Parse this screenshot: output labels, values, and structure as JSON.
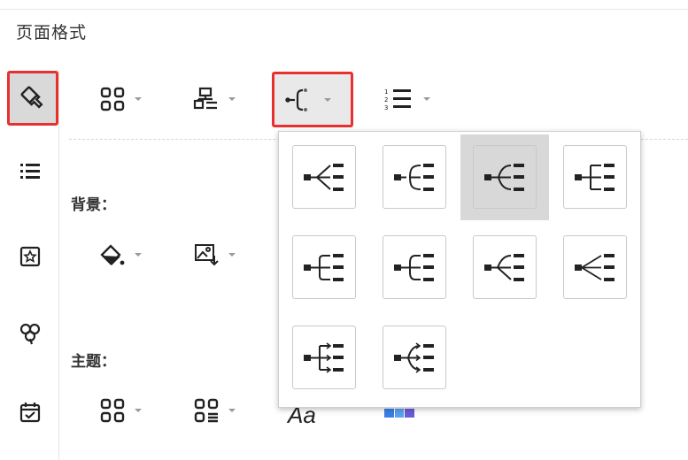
{
  "panel": {
    "title": "页面格式"
  },
  "sections": {
    "background_label": "背景：",
    "theme_label": "主题："
  },
  "sidebar": {
    "items": [
      {
        "icon": "format-brush-icon",
        "active": true
      },
      {
        "icon": "list-icon",
        "active": false
      },
      {
        "icon": "star-frame-icon",
        "active": false
      },
      {
        "icon": "clover-icon",
        "active": false
      },
      {
        "icon": "calendar-check-icon",
        "active": false
      }
    ]
  },
  "toolbar": {
    "buttons": [
      {
        "icon": "layout-grid-icon"
      },
      {
        "icon": "org-structure-icon"
      },
      {
        "icon": "branch-style-icon",
        "highlighted": true
      },
      {
        "icon": "numbered-list-icon",
        "label_numbers": [
          "1",
          "2",
          "3"
        ]
      }
    ]
  },
  "background_tools": [
    {
      "icon": "fill-bucket-icon"
    },
    {
      "icon": "background-image-icon"
    }
  ],
  "theme_tools": [
    {
      "icon": "theme-grid-icon"
    },
    {
      "icon": "theme-list-icon"
    },
    {
      "icon": "font-icon",
      "text": "Aa"
    },
    {
      "icon": "color-palette-icon"
    }
  ],
  "branch_popup": {
    "options": [
      {
        "style": "straight-fan"
      },
      {
        "style": "curve-bracket"
      },
      {
        "style": "curve-bracket-selected",
        "selected": true
      },
      {
        "style": "right-angle"
      },
      {
        "style": "round-bracket"
      },
      {
        "style": "round-bracket-compact"
      },
      {
        "style": "mixed-curve"
      },
      {
        "style": "straight-fan-thin"
      },
      {
        "style": "arrow-right-angle"
      },
      {
        "style": "arrow-curve"
      }
    ]
  },
  "colors": {
    "accent_red": "#e8312f",
    "icon_dark": "#222222",
    "selected_bg": "#d8d8d8"
  }
}
